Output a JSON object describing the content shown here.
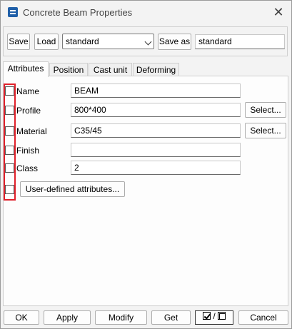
{
  "window": {
    "title": "Concrete Beam Properties",
    "close_glyph": "✕"
  },
  "toolbar": {
    "save_label": "Save",
    "load_label": "Load",
    "load_value": "standard",
    "save_as_label": "Save as",
    "save_as_value": "standard"
  },
  "tabs": [
    {
      "label": "Attributes",
      "active": true
    },
    {
      "label": "Position"
    },
    {
      "label": "Cast unit"
    },
    {
      "label": "Deforming"
    }
  ],
  "attributes": {
    "name": {
      "label": "Name",
      "value": "BEAM"
    },
    "profile": {
      "label": "Profile",
      "value": "800*400",
      "button": "Select..."
    },
    "material": {
      "label": "Material",
      "value": "C35/45",
      "button": "Select..."
    },
    "finish": {
      "label": "Finish",
      "value": ""
    },
    "class": {
      "label": "Class",
      "value": "2"
    },
    "user_defined_button": "User-defined attributes..."
  },
  "footer": {
    "ok_label": "OK",
    "apply_label": "Apply",
    "modify_label": "Modify",
    "get_label": "Get",
    "toggle_separator": "/",
    "cancel_label": "Cancel"
  },
  "colors": {
    "highlight": "#e0202a",
    "icon": "#1f5fa8"
  }
}
